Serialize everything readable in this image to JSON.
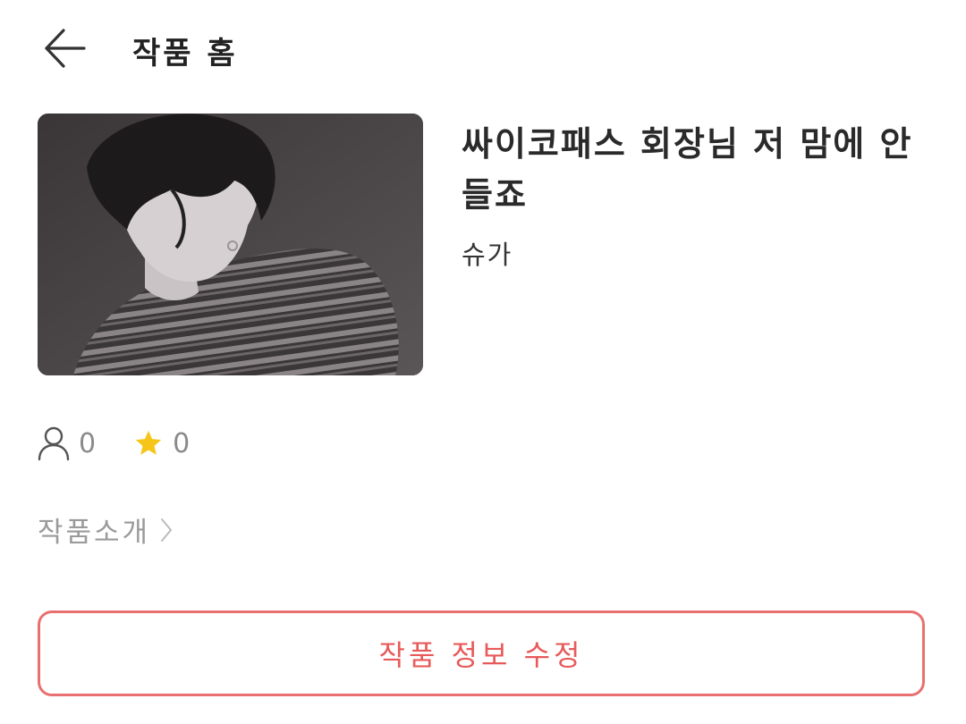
{
  "header": {
    "back_icon": "arrow-left-icon",
    "title": "작품 홈"
  },
  "work": {
    "cover_image": "black-and-white portrait, striped sweater",
    "title": "싸이코패스 회장님 저 맘에 안 들죠",
    "author": "슈가"
  },
  "stats": {
    "readers_icon": "person-icon",
    "readers": "0",
    "favorites_icon": "star-icon",
    "favorites": "0",
    "star_color": "#F5C518"
  },
  "intro": {
    "label": "작품소개",
    "icon": "chevron-right-icon"
  },
  "actions": {
    "edit_label": "작품 정보 수정",
    "accent_color": "#E87070"
  }
}
